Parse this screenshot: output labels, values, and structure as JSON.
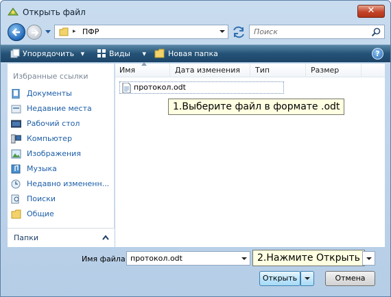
{
  "window": {
    "title": "Открыть файл",
    "close_glyph": "✕"
  },
  "address": {
    "path": "ПФР",
    "separator": "▸"
  },
  "search": {
    "placeholder": "Поиск"
  },
  "toolbar": {
    "organize_label": "Упорядочить",
    "views_label": "Виды",
    "new_folder_label": "Новая папка",
    "help_glyph": "?"
  },
  "sidebar": {
    "favorites_heading": "Избранные ссылки",
    "items": [
      {
        "label": "Документы",
        "icon": "documents-icon"
      },
      {
        "label": "Недавние места",
        "icon": "recent-places-icon"
      },
      {
        "label": "Рабочий стол",
        "icon": "desktop-icon"
      },
      {
        "label": "Компьютер",
        "icon": "computer-icon"
      },
      {
        "label": "Изображения",
        "icon": "pictures-icon"
      },
      {
        "label": "Музыка",
        "icon": "music-icon"
      },
      {
        "label": "Недавно измененн...",
        "icon": "recently-changed-icon"
      },
      {
        "label": "Поиски",
        "icon": "searches-icon"
      },
      {
        "label": "Общие",
        "icon": "public-icon"
      }
    ],
    "folders_label": "Папки"
  },
  "file_list": {
    "columns": [
      "Имя",
      "Дата изменения",
      "Тип",
      "Размер"
    ],
    "files": [
      {
        "name": "протокол.odt",
        "icon": "odt-document-icon"
      }
    ]
  },
  "callouts": {
    "step1": "1.Выберите файл в формате .odt",
    "step2": "2.Нажмите Открыть"
  },
  "bottom": {
    "filename_label": "Имя файла:",
    "filename_value": "протокол.odt",
    "open_label": "Открыть",
    "cancel_label": "Отмена"
  }
}
